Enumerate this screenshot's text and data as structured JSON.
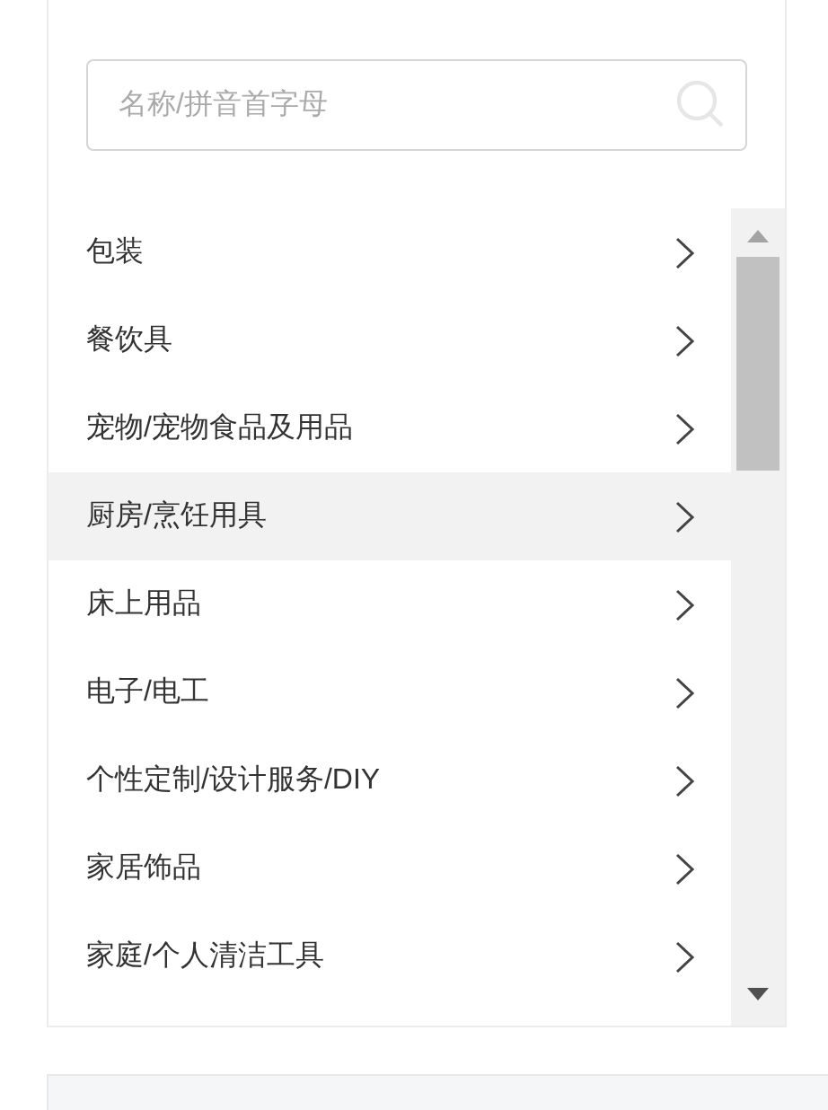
{
  "search": {
    "placeholder": "名称/拼音首字母"
  },
  "categories": [
    {
      "label": "包装",
      "selected": false
    },
    {
      "label": "餐饮具",
      "selected": false
    },
    {
      "label": "宠物/宠物食品及用品",
      "selected": false
    },
    {
      "label": "厨房/烹饪用具",
      "selected": true
    },
    {
      "label": "床上用品",
      "selected": false
    },
    {
      "label": "电子/电工",
      "selected": false
    },
    {
      "label": "个性定制/设计服务/DIY",
      "selected": false
    },
    {
      "label": "家居饰品",
      "selected": false
    },
    {
      "label": "家庭/个人清洁工具",
      "selected": false
    }
  ]
}
